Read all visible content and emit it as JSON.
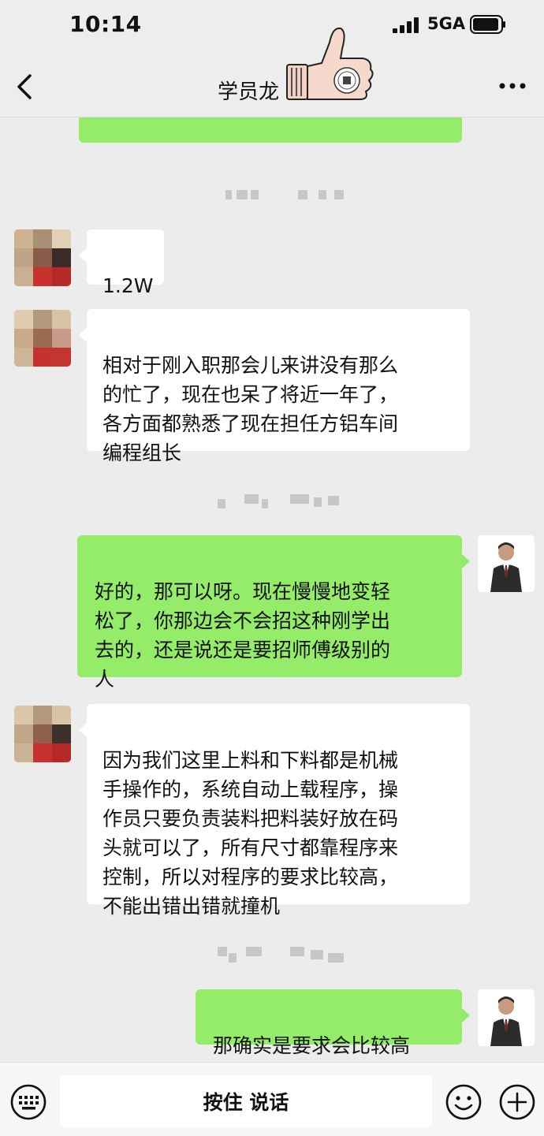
{
  "status_bar": {
    "time": "10:14",
    "network": "5GA",
    "icons": [
      "signal-icon",
      "battery-icon"
    ]
  },
  "nav": {
    "title": "学员龙",
    "icons": [
      "back-icon",
      "thumbs-up-sticker",
      "more-icon"
    ]
  },
  "colors": {
    "background": "#ececec",
    "outgoing_bubble": "#95ec69",
    "incoming_bubble": "#ffffff"
  },
  "messages": [
    {
      "direction": "in",
      "text": "1.2W"
    },
    {
      "direction": "in",
      "text": "相对于刚入职那会儿来讲没有那么\n的忙了，现在也呆了将近一年了，\n各方面都熟悉了现在担任方铝车间\n编程组长"
    },
    {
      "direction": "out",
      "text": "好的，那可以呀。现在慢慢地变轻\n松了，你那边会不会招这种刚学出\n去的，还是说还是要招师傅级别的\n人"
    },
    {
      "direction": "in",
      "text": "因为我们这里上料和下料都是机械\n手操作的，系统自动上载程序，操\n作员只要负责装料把料装好放在码\n头就可以了，所有尺寸都靠程序来\n控制，所以对程序的要求比较高，\n不能出错出错就撞机"
    },
    {
      "direction": "out",
      "text": "那确实是要求会比较高"
    }
  ],
  "input_bar": {
    "hold_to_talk": "按住 说话",
    "icons": [
      "keyboard-icon",
      "emoji-icon",
      "plus-icon"
    ]
  }
}
